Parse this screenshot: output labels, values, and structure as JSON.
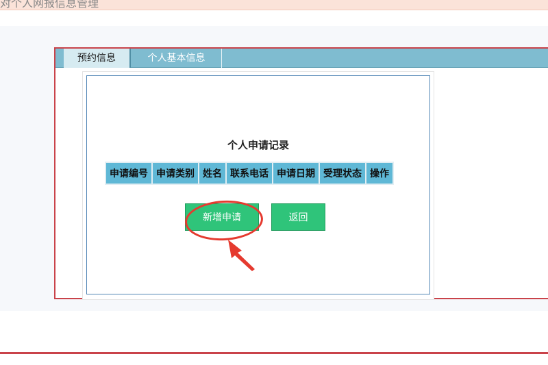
{
  "banner": {
    "text": "对个人网报信息管理"
  },
  "tabs": [
    {
      "label": "预约信息"
    },
    {
      "label": "个人基本信息"
    }
  ],
  "records": {
    "title": "个人申请记录",
    "columns": [
      "申请编号",
      "申请类别",
      "姓名",
      "联系电话",
      "申请日期",
      "受理状态",
      "操作"
    ]
  },
  "buttons": {
    "new_label": "新增申请",
    "back_label": "返回"
  },
  "colors": {
    "frame_border": "#c9434a",
    "tab_bar": "#7fbcd0",
    "table_header": "#5fb8d6",
    "button": "#2fc47a",
    "annotation": "#e53a2f"
  }
}
